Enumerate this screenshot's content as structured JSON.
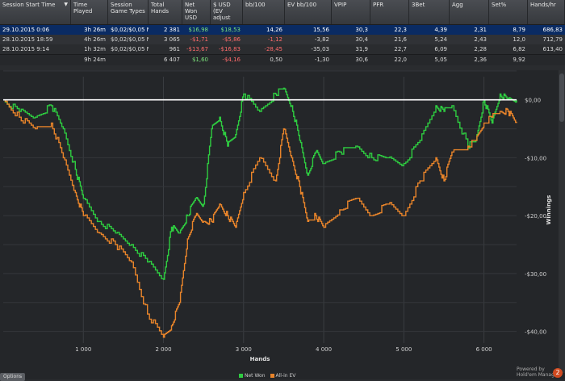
{
  "table": {
    "columns": [
      {
        "key": "start",
        "label": "Session Start Time",
        "sort": "▼",
        "w": 88
      },
      {
        "key": "time",
        "label": "Time Played",
        "w": 46
      },
      {
        "key": "games",
        "label": "Session Game Types",
        "w": 50
      },
      {
        "key": "hands",
        "label": "Total Hands",
        "w": 42
      },
      {
        "key": "net",
        "label": "Net Won USD",
        "w": 35
      },
      {
        "key": "ev",
        "label": "$ USD (EV adjust",
        "w": 40
      },
      {
        "key": "bb100",
        "label": "bb/100",
        "w": 52
      },
      {
        "key": "evbb",
        "label": "EV bb/100",
        "w": 58
      },
      {
        "key": "vpip",
        "label": "VPIP",
        "w": 48
      },
      {
        "key": "pfr",
        "label": "PFR",
        "w": 48
      },
      {
        "key": "threebet",
        "label": "3Bet",
        "w": 50
      },
      {
        "key": "agg",
        "label": "Agg",
        "w": 49
      },
      {
        "key": "setpct",
        "label": "Set%",
        "w": 48
      },
      {
        "key": "handshr",
        "label": "Hands/hr",
        "w": 46
      }
    ],
    "rows": [
      {
        "start": "29.10.2015 0:06",
        "time": "3h 26m",
        "games": "$0,02/$0,05 NL",
        "hands": "2 381",
        "net": "$16,98",
        "ev": "$18,53",
        "bb100": "14,26",
        "evbb": "15,56",
        "vpip": "30,3",
        "pfr": "22,3",
        "threebet": "4,39",
        "agg": "2,31",
        "setpct": "8,79",
        "handshr": "686,83",
        "selected": true
      },
      {
        "start": "28.10.2015 18:59",
        "time": "4h 26m",
        "games": "$0,02/$0,05 NL",
        "hands": "3 065",
        "net": "-$1,71",
        "ev": "-$5,86",
        "bb100": "-1,12",
        "evbb": "-3,82",
        "vpip": "30,4",
        "pfr": "21,6",
        "threebet": "5,24",
        "agg": "2,43",
        "setpct": "12,0",
        "handshr": "712,79"
      },
      {
        "start": "28.10.2015 9:14",
        "time": "1h 32m",
        "games": "$0,02/$0,05 NL",
        "hands": "961",
        "net": "-$13,67",
        "ev": "-$16,83",
        "bb100": "-28,45",
        "evbb": "-35,03",
        "vpip": "31,9",
        "pfr": "22,7",
        "threebet": "6,09",
        "agg": "2,28",
        "setpct": "6,82",
        "handshr": "613,40"
      }
    ],
    "total": {
      "start": "",
      "time": "9h 24m",
      "games": "",
      "hands": "6 407",
      "net": "$1,60",
      "ev": "-$4,16",
      "bb100": "0,50",
      "evbb": "-1,30",
      "vpip": "30,6",
      "pfr": "22,0",
      "threebet": "5,05",
      "agg": "2,36",
      "setpct": "9,92",
      "handshr": ""
    }
  },
  "chart_data": {
    "type": "line",
    "xlabel": "Hands",
    "ylabel": "Winnings",
    "xlim": [
      0,
      6407
    ],
    "ylim": [
      -42,
      4
    ],
    "x_ticks": [
      1000,
      2000,
      3000,
      4000,
      5000,
      6000
    ],
    "x_tick_labels": [
      "1 000",
      "2 000",
      "3 000",
      "4 000",
      "5 000",
      "6 000"
    ],
    "y_ticks": [
      0,
      -10,
      -20,
      -30,
      -40
    ],
    "y_tick_labels": [
      "$0,00",
      "-$10,00",
      "-$20,00",
      "-$30,00",
      "-$40,00"
    ],
    "grid": true,
    "legend_position": "bottom",
    "series": [
      {
        "name": "Net Won",
        "color": "#2ecc40",
        "x": [
          0,
          200,
          400,
          600,
          750,
          900,
          1000,
          1200,
          1400,
          1600,
          1800,
          2000,
          2100,
          2200,
          2300,
          2400,
          2500,
          2600,
          2700,
          2800,
          2900,
          3000,
          3200,
          3400,
          3500,
          3600,
          3700,
          3800,
          3900,
          4000,
          4200,
          4400,
          4600,
          4800,
          5000,
          5200,
          5400,
          5500,
          5600,
          5800,
          5900,
          6000,
          6100,
          6200,
          6300,
          6407
        ],
        "y": [
          0,
          -2,
          -3,
          -1,
          -5,
          -12,
          -17,
          -21,
          -23,
          -25,
          -28,
          -31,
          -22,
          -23,
          -20,
          -17,
          -18,
          -5,
          -3,
          -8,
          -6,
          1,
          -2,
          1,
          2,
          -1,
          -7,
          -13,
          -9,
          -11,
          -9,
          -8,
          -10,
          -10,
          -11,
          -7,
          -1,
          -2,
          -1,
          -8,
          -7,
          0,
          -4,
          1,
          0,
          0
        ]
      },
      {
        "name": "All-in EV",
        "color": "#e8842a",
        "x": [
          0,
          200,
          400,
          600,
          750,
          900,
          1000,
          1200,
          1400,
          1600,
          1800,
          2000,
          2100,
          2200,
          2300,
          2400,
          2500,
          2600,
          2700,
          2800,
          2900,
          3000,
          3200,
          3400,
          3500,
          3600,
          3700,
          3800,
          3900,
          4000,
          4200,
          4400,
          4600,
          4800,
          5000,
          5200,
          5400,
          5500,
          5600,
          5800,
          5900,
          6000,
          6100,
          6200,
          6300,
          6407
        ],
        "y": [
          0,
          -3,
          -5,
          -4,
          -10,
          -16,
          -20,
          -23,
          -25,
          -28,
          -37,
          -41,
          -39,
          -35,
          -24,
          -20,
          -21,
          -21,
          -18,
          -20,
          -22,
          -16,
          -10,
          -14,
          -5,
          -10,
          -15,
          -21,
          -20,
          -22,
          -19,
          -17,
          -20,
          -18,
          -20,
          -14,
          -10,
          -14,
          -9,
          -8,
          -7,
          -4,
          -3,
          -2,
          -2,
          -4
        ]
      },
      {
        "name": "",
        "color": "#ffffff",
        "x": [
          0,
          6407
        ],
        "y": [
          0,
          0
        ]
      }
    ]
  },
  "legend": {
    "items": [
      {
        "label": "Net Won",
        "color": "#2ecc40"
      },
      {
        "label": "All-in EV",
        "color": "#e8842a"
      }
    ]
  },
  "footer": {
    "options_label": "Options",
    "brand_line1": "Powered by",
    "brand_line2": "Hold'em Manager",
    "brand_mark": "2"
  }
}
